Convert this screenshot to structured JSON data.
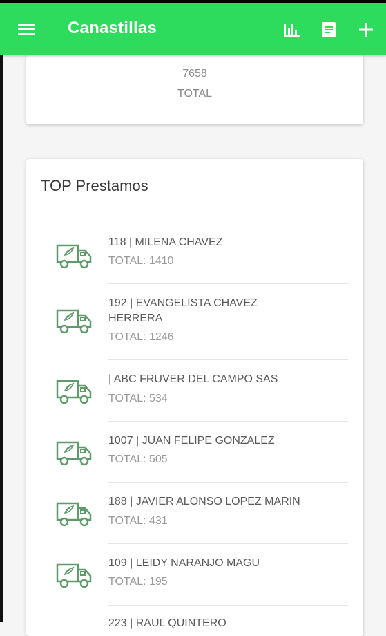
{
  "appbar": {
    "title": "Canastillas",
    "icons": [
      "menu-icon",
      "bar-chart-icon",
      "document-icon",
      "add-icon"
    ],
    "color": "#2ddc5c"
  },
  "summary": {
    "value": "7658",
    "label": "TOTAL"
  },
  "top_list": {
    "heading": "TOP Prestamos",
    "items": [
      {
        "name": "118 | MILENA CHAVEZ",
        "total": "TOTAL: 1410"
      },
      {
        "name": "192 | EVANGELISTA CHAVEZ HERRERA",
        "total": "TOTAL: 1246"
      },
      {
        "name": "| ABC FRUVER DEL CAMPO SAS",
        "total": "TOTAL: 534"
      },
      {
        "name": "1007 | JUAN FELIPE GONZALEZ",
        "total": "TOTAL: 505"
      },
      {
        "name": "188 | JAVIER ALONSO LOPEZ MARIN",
        "total": "TOTAL: 431"
      },
      {
        "name": "109 | LEIDY NARANJO MAGU",
        "total": "TOTAL: 195"
      },
      {
        "name": "223 | RAUL QUINTERO",
        "total": ""
      }
    ]
  },
  "icon_color": "#5e9a6a"
}
